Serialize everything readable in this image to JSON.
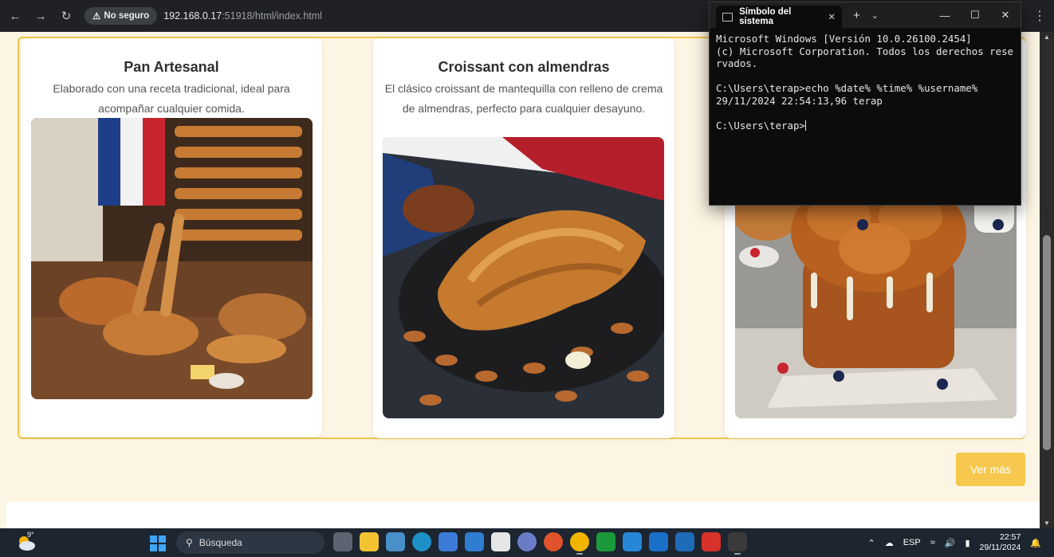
{
  "browser": {
    "insecure_label": "No seguro",
    "url_host": "192.168.0.17",
    "url_rest": ":51918/html/index.html"
  },
  "cards": [
    {
      "title": "Pan Artesanal",
      "description": "Elaborado con una receta tradicional, ideal para acompañar cualquier comida."
    },
    {
      "title": "Croissant con almendras",
      "description": "El clásico croissant de mantequilla con relleno de crema de almendras, perfecto para cualquier desayuno."
    }
  ],
  "button": {
    "ver_mas": "Ver más"
  },
  "terminal": {
    "tab_title": "Símbolo del sistema",
    "output": "Microsoft Windows [Versión 10.0.26100.2454]\n(c) Microsoft Corporation. Todos los derechos reservados.\n\nC:\\Users\\terap>echo %date% %time% %username%\n29/11/2024 22:54:13,96 terap\n\nC:\\Users\\terap>"
  },
  "taskbar": {
    "weather_temp": "9°",
    "search_placeholder": "Búsqueda",
    "language": "ESP",
    "time": "22:57",
    "date": "29/11/2024"
  },
  "colors": {
    "accent": "#f6c84d",
    "page_bg": "#fdf5e4",
    "card_border": "#f0c64a"
  }
}
